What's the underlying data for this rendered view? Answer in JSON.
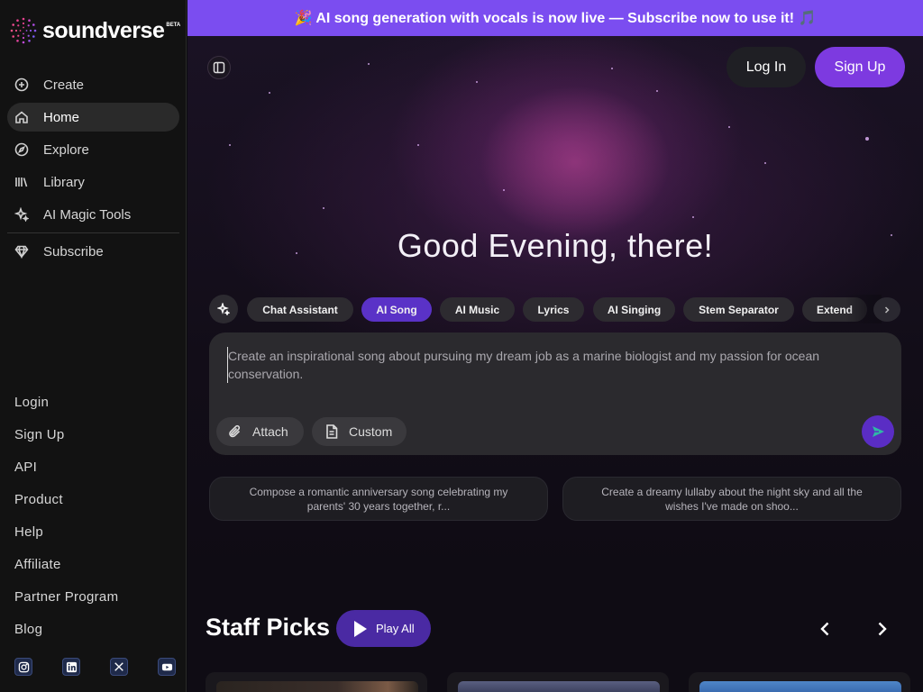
{
  "brand": {
    "name_part1": "sound",
    "name_part2": "verse",
    "beta": "BETA"
  },
  "banner": {
    "text": "🎉 AI song generation with vocals is now live — Subscribe now to use it! 🎵"
  },
  "sidebar": {
    "nav": [
      {
        "label": "Create",
        "icon": "plus-circle-icon"
      },
      {
        "label": "Home",
        "icon": "home-icon",
        "active": true
      },
      {
        "label": "Explore",
        "icon": "compass-icon"
      },
      {
        "label": "Library",
        "icon": "library-icon"
      },
      {
        "label": "AI Magic Tools",
        "icon": "sparkles-icon"
      }
    ],
    "subscribe": {
      "label": "Subscribe",
      "icon": "diamond-icon"
    },
    "footer_links": [
      "Login",
      "Sign Up",
      "API",
      "Product",
      "Help",
      "Affiliate",
      "Partner Program",
      "Blog"
    ],
    "socials": [
      "instagram-icon",
      "linkedin-icon",
      "x-icon",
      "youtube-icon"
    ]
  },
  "header": {
    "login_label": "Log In",
    "signup_label": "Sign Up"
  },
  "hero": {
    "greeting": "Good Evening, there!"
  },
  "chips": [
    {
      "label": "Chat Assistant"
    },
    {
      "label": "AI Song",
      "active": true
    },
    {
      "label": "AI Music"
    },
    {
      "label": "Lyrics"
    },
    {
      "label": "AI Singing"
    },
    {
      "label": "Stem Separator"
    },
    {
      "label": "Extend"
    }
  ],
  "prompt": {
    "placeholder": "Create an inspirational song about pursuing my dream job as a marine biologist and my passion for ocean conservation.",
    "attach_label": "Attach",
    "custom_label": "Custom"
  },
  "suggestions": [
    "Compose a romantic anniversary song celebrating my parents' 30 years together, r...",
    "Create a dreamy lullaby about the night sky and all the wishes I've made on shoo..."
  ],
  "staff_picks": {
    "title": "Staff Picks",
    "play_all_label": "Play All"
  },
  "colors": {
    "accent": "#7d3ae0",
    "banner": "#7b4df0",
    "active_chip": "#5a32c7"
  }
}
